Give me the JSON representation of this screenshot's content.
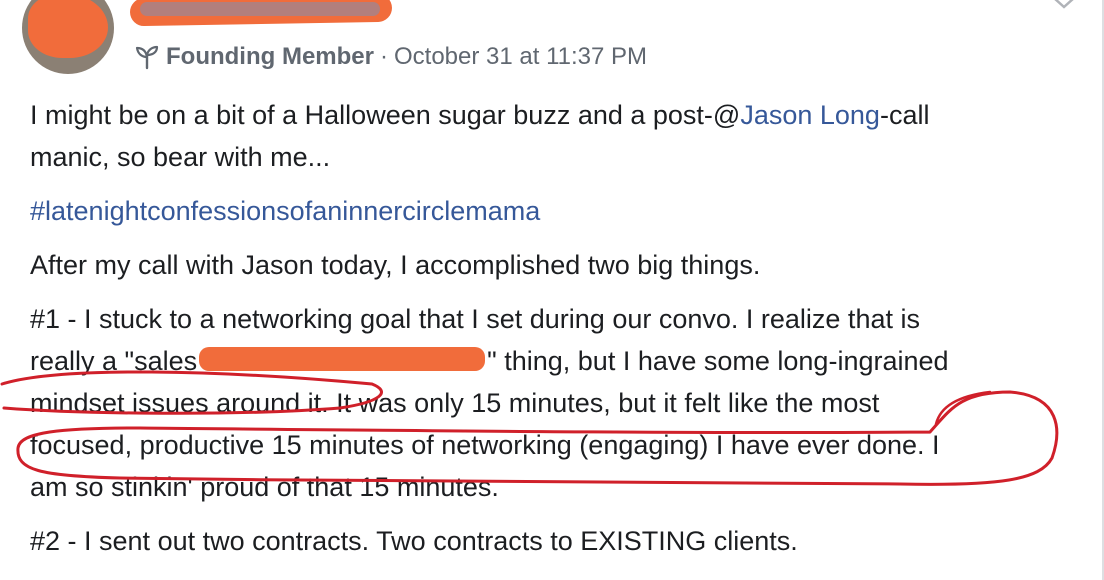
{
  "post": {
    "badge_label": "Founding Member",
    "separator": "·",
    "timestamp": "October 31 at 11:37 PM",
    "para1_line1_before": "I might be on a bit of a Halloween sugar buzz and a post-@",
    "para1_mention": "Jason Long",
    "para1_line1_after": "-call",
    "para1_line2": "manic, so bear with me...",
    "hashtag": "#latenightconfessionsofaninnercirclemama",
    "para3": "After my call with Jason today, I accomplished two big things.",
    "para4_line1": "#1 - I stuck to a networking goal that I set during our convo. I realize that is",
    "para4_line2_before": "really a \"sales",
    "para4_line2_after": "\" thing, but I have some long-ingrained",
    "para4_line3": "mindset issues around it. It was only 15 minutes, but it felt like the most",
    "para4_line4": "focused, productive 15 minutes of networking (engaging) I have ever done. I",
    "para4_line5": "am so stinkin' proud of that 15 minutes.",
    "para5": "#2 - I sent out two contracts. Two contracts to EXISTING clients."
  },
  "icons": {
    "badge_icon": "sprout-icon",
    "menu_icon": "chevron-down-icon"
  },
  "colors": {
    "text": "#1c1e21",
    "meta": "#606770",
    "link": "#365899",
    "redaction": "#f16c3b",
    "annotation": "#d0202a"
  }
}
